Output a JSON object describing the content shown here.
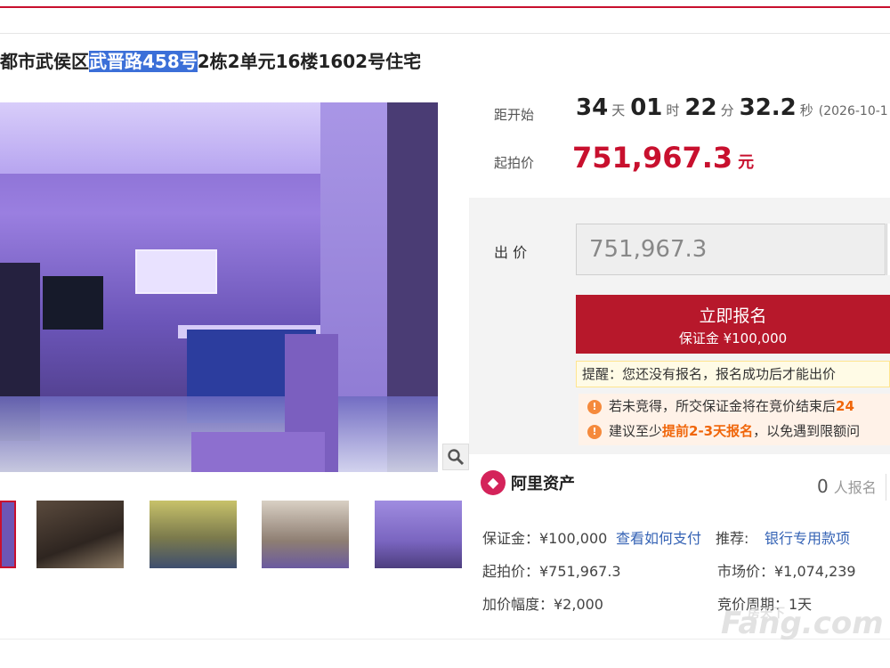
{
  "title": {
    "prefix": "都市武侯区",
    "highlight": "武晋路458号",
    "suffix": "2栋2单元16楼1602号住宅"
  },
  "countdown": {
    "label": "距开始",
    "days": "34",
    "days_unit": "天",
    "hours": "01",
    "hours_unit": "时",
    "minutes": "22",
    "minutes_unit": "分",
    "seconds": "32.2",
    "seconds_unit": "秒",
    "date": "(2026-10-1"
  },
  "start_price": {
    "label": "起拍价",
    "value": "751,967.3",
    "unit": "元"
  },
  "bid": {
    "label": "出 价",
    "value": "751,967.3"
  },
  "register": {
    "label": "立即报名",
    "deposit": "保证金 ¥100,000"
  },
  "tip": "提醒：您还没有报名，报名成功后才能出价",
  "warnings": {
    "w1_text": "若未竞得，所交保证金将在竞价结束后",
    "w1_highlight": "24",
    "w2_pre": "建议至少",
    "w2_highlight": "提前2-3天报名",
    "w2_post": "，以免遇到限额问"
  },
  "seller": {
    "logo": "◆",
    "name": "阿里资产",
    "count": "0",
    "count_unit": "人报名"
  },
  "details": {
    "deposit": "保证金：¥100,000",
    "how_to_pay": "查看如何支付",
    "recommend_label": "推荐:",
    "recommend_link": "银行专用款项",
    "start_price": "起拍价：¥751,967.3",
    "market_price": "市场价：¥1,074,239",
    "increment": "加价幅度：¥2,000",
    "cycle": "竞价周期：1天"
  },
  "zoom_icon": "search-icon",
  "watermark": {
    "brand": "Fang.com",
    "cn": "房天下"
  },
  "colors": {
    "accent": "#c8102e",
    "button": "#b7182b",
    "link": "#3563b5",
    "highlight": "#f0660a"
  }
}
